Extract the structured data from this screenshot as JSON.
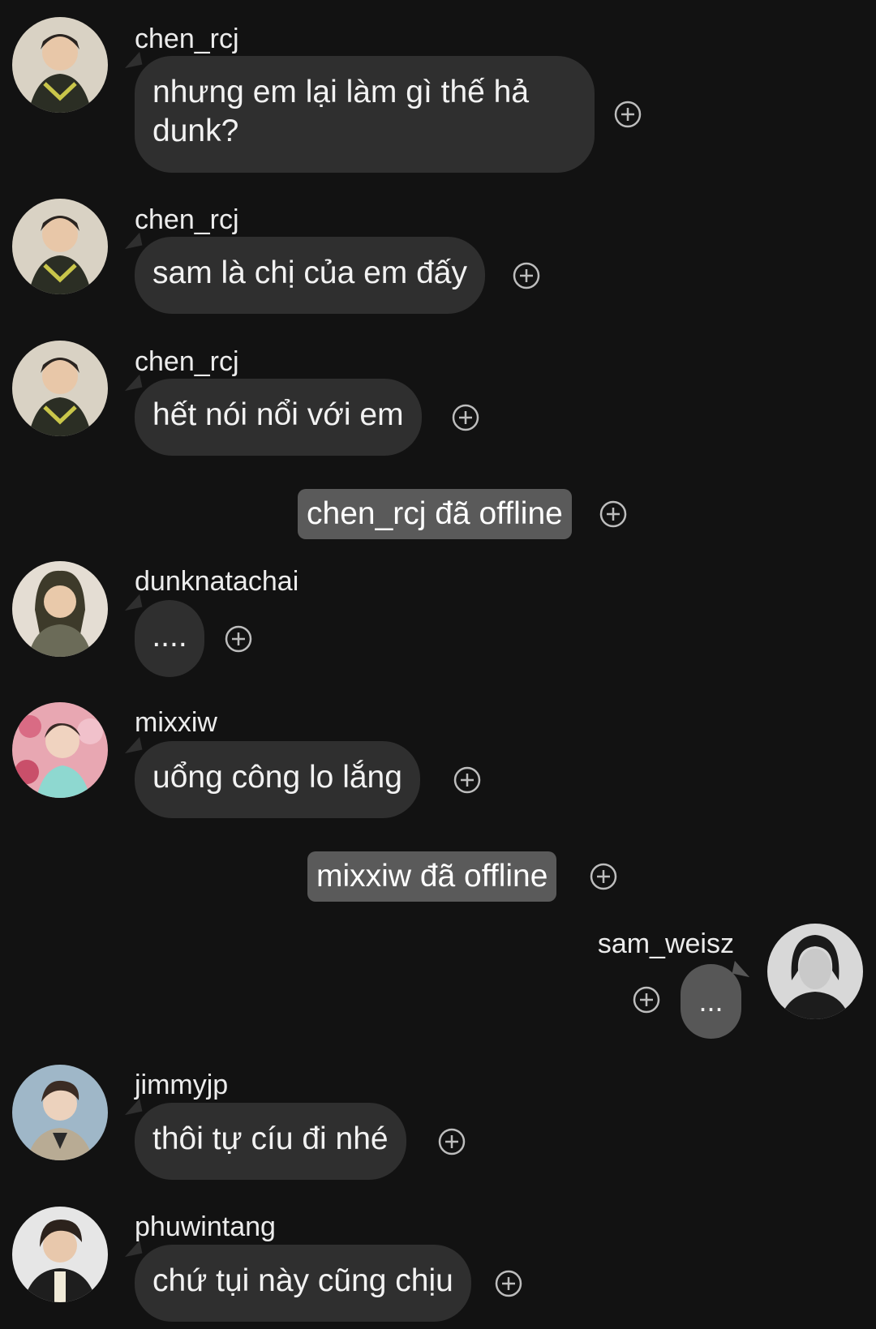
{
  "messages": [
    {
      "user": "chen_rcj",
      "text": "nhưng em lại làm gì thế hả dunk?"
    },
    {
      "user": "chen_rcj",
      "text": "sam là chị của em đấy"
    },
    {
      "user": "chen_rcj",
      "text": "hết nói nổi với em"
    },
    {
      "system": "chen_rcj đã offline"
    },
    {
      "user": "dunknatachai",
      "text": "...."
    },
    {
      "user": "mixxiw",
      "text": "uổng công lo lắng"
    },
    {
      "system": "mixxiw đã offline"
    },
    {
      "user": "sam_weisz",
      "text": "...",
      "mine": true
    },
    {
      "user": "jimmyjp",
      "text": "thôi tự cíu đi nhé"
    },
    {
      "user": "phuwintang",
      "text": "chứ tụi này cũng chịu"
    }
  ],
  "icons": {
    "react": "plus-circle-icon",
    "avatar": "user-avatar"
  },
  "colors": {
    "background": "#121212",
    "bubble": "#2f2f2f",
    "system_bubble": "#5a5a5a",
    "own_bubble": "#575757",
    "text": "#f2f2f2"
  }
}
